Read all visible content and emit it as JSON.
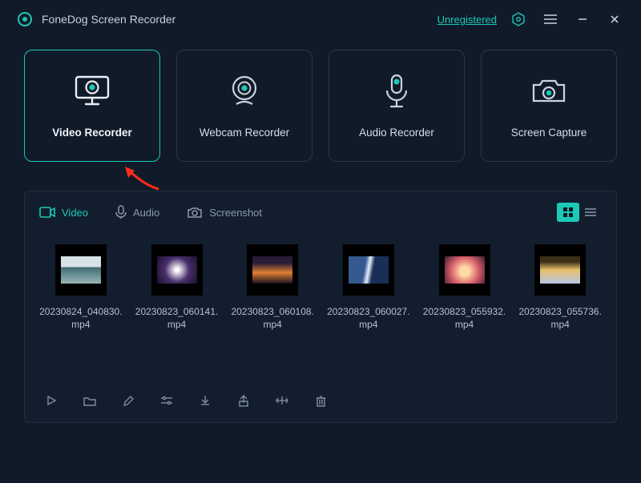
{
  "app": {
    "title": "FoneDog Screen Recorder",
    "unregistered": "Unregistered"
  },
  "modes": {
    "video": "Video Recorder",
    "webcam": "Webcam Recorder",
    "audio": "Audio Recorder",
    "capture": "Screen Capture"
  },
  "tabs": {
    "video": "Video",
    "audio": "Audio",
    "screenshot": "Screenshot"
  },
  "files": [
    {
      "name": "20230824_040830.mp4"
    },
    {
      "name": "20230823_060141.mp4"
    },
    {
      "name": "20230823_060108.mp4"
    },
    {
      "name": "20230823_060027.mp4"
    },
    {
      "name": "20230823_055932.mp4"
    },
    {
      "name": "20230823_055736.mp4"
    }
  ],
  "colors": {
    "accent": "#1cc9b7"
  }
}
